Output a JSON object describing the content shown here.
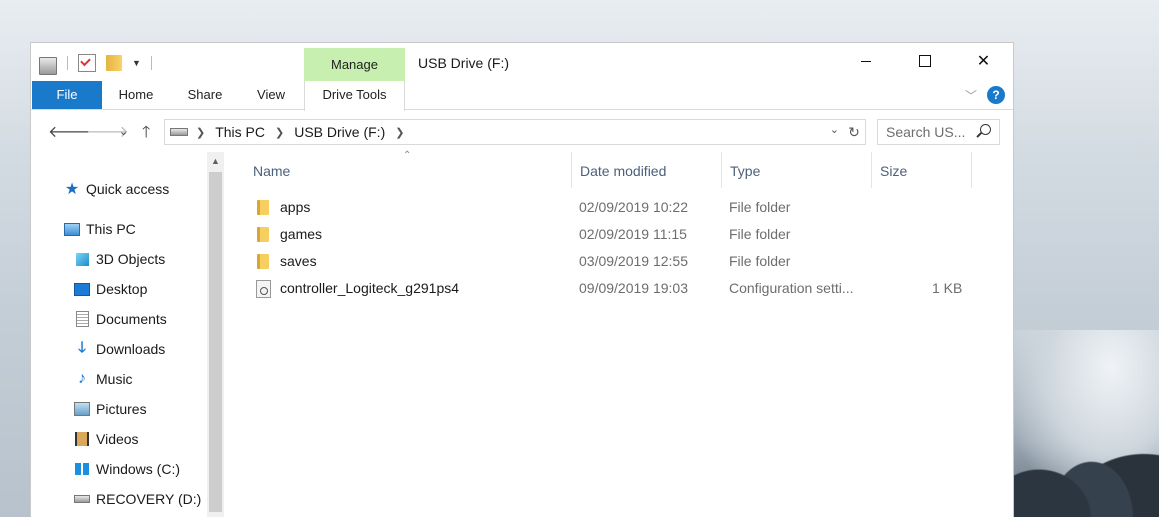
{
  "window": {
    "title": "USB Drive (F:)",
    "manage_label": "Manage",
    "controls": [
      "minimize",
      "maximize",
      "close"
    ]
  },
  "ribbon": {
    "tabs": [
      "File",
      "Home",
      "Share",
      "View",
      "Drive Tools"
    ],
    "file_color": "#1979ca",
    "manage_color": "#c6efb0",
    "help_glyph": "?"
  },
  "address": {
    "crumbs": [
      "This PC",
      "USB Drive (F:)"
    ],
    "search_placeholder": "Search US..."
  },
  "nav": {
    "items": [
      {
        "label": "Quick access",
        "icon": "star-icon"
      },
      {
        "label": "This PC",
        "icon": "this-pc-icon"
      },
      {
        "label": "3D Objects",
        "icon": "3d-objects-icon"
      },
      {
        "label": "Desktop",
        "icon": "desktop-icon"
      },
      {
        "label": "Documents",
        "icon": "documents-icon"
      },
      {
        "label": "Downloads",
        "icon": "downloads-icon"
      },
      {
        "label": "Music",
        "icon": "music-icon"
      },
      {
        "label": "Pictures",
        "icon": "pictures-icon"
      },
      {
        "label": "Videos",
        "icon": "videos-icon"
      },
      {
        "label": "Windows (C:)",
        "icon": "windows-drive-icon"
      },
      {
        "label": "RECOVERY (D:)",
        "icon": "drive-icon"
      }
    ]
  },
  "files": {
    "columns": [
      "Name",
      "Date modified",
      "Type",
      "Size"
    ],
    "rows": [
      {
        "name": "apps",
        "date": "02/09/2019 10:22",
        "type": "File folder",
        "size": "",
        "icon": "folder-icon"
      },
      {
        "name": "games",
        "date": "02/09/2019 11:15",
        "type": "File folder",
        "size": "",
        "icon": "folder-icon"
      },
      {
        "name": "saves",
        "date": "03/09/2019 12:55",
        "type": "File folder",
        "size": "",
        "icon": "folder-icon"
      },
      {
        "name": "controller_Logiteck_g291ps4",
        "date": "09/09/2019 19:03",
        "type": "Configuration setti...",
        "size": "1 KB",
        "icon": "config-file-icon"
      }
    ]
  }
}
